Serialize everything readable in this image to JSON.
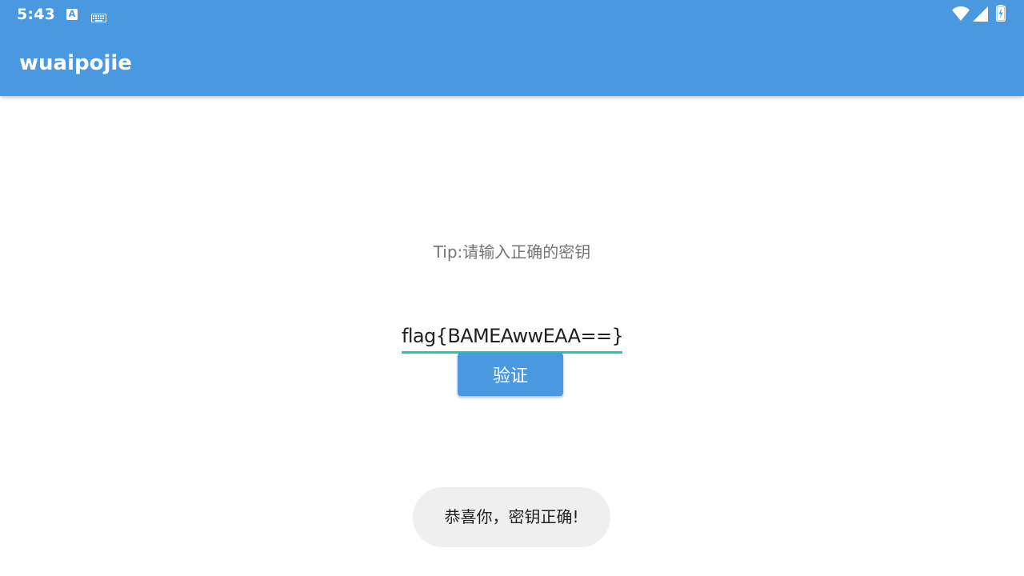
{
  "status_bar": {
    "time": "5:43",
    "notification_icons": [
      "text-a-icon",
      "keyboard-icon"
    ],
    "system_icons": [
      "wifi-icon",
      "cell-signal-icon",
      "battery-charging-icon"
    ]
  },
  "app_bar": {
    "title": "wuaipojie",
    "color": "#4a98e0"
  },
  "main": {
    "tip": "Tip:请输入正确的密钥",
    "key_input": {
      "value": "flag{BAMEAwwEAA==}",
      "underline_color": "#1dc8c0"
    },
    "verify_button": {
      "label": "验证",
      "color": "#4a98e0"
    }
  },
  "toast": {
    "message": "恭喜你，密钥正确!"
  }
}
